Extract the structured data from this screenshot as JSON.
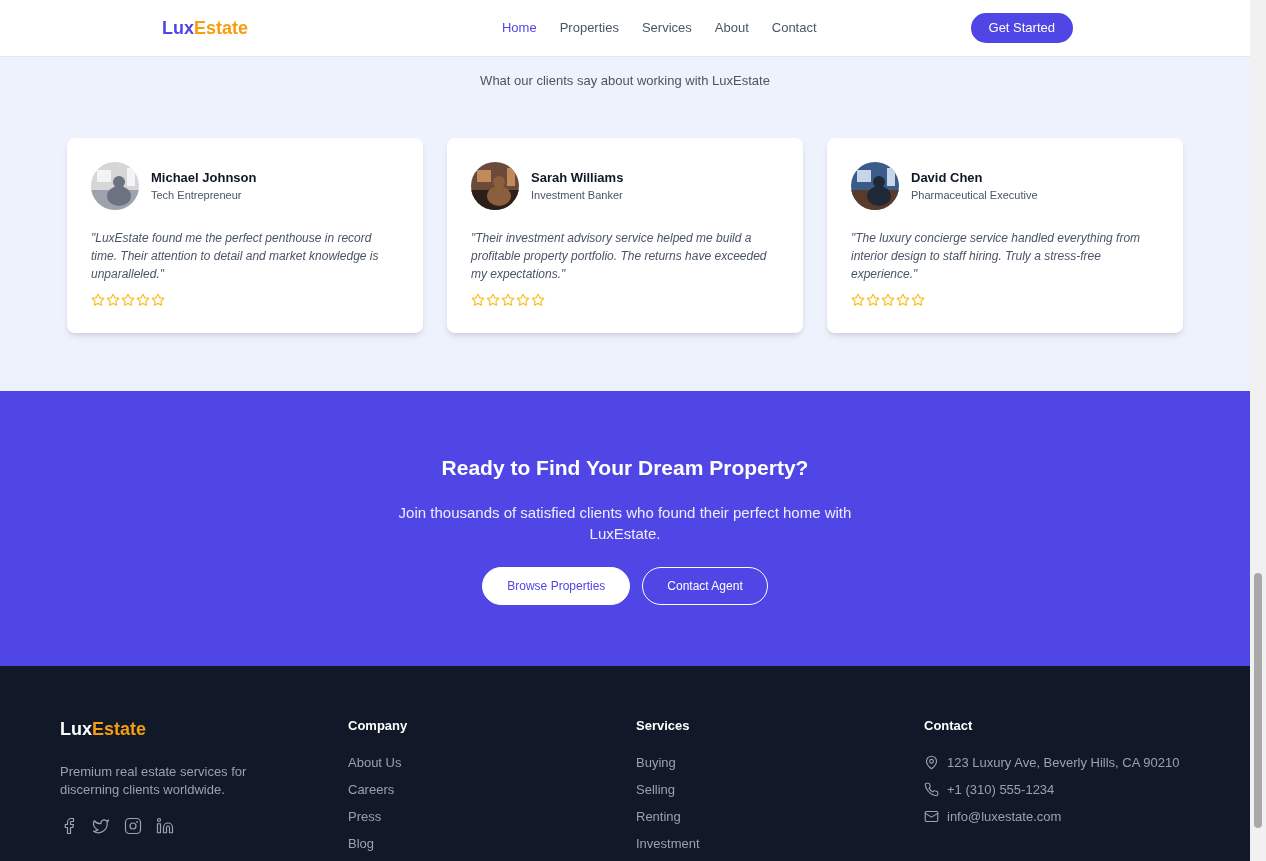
{
  "nav": {
    "logo": {
      "first": "Lux",
      "second": "Estate"
    },
    "links": [
      {
        "label": "Home",
        "selected": true
      },
      {
        "label": "Properties",
        "selected": false
      },
      {
        "label": "Services",
        "selected": false
      },
      {
        "label": "About",
        "selected": false
      },
      {
        "label": "Contact",
        "selected": false
      }
    ],
    "cta": "Get Started"
  },
  "testimonials": {
    "subtitle": "What our clients say about working with LuxEstate",
    "items": [
      {
        "name": "Michael Johnson",
        "role": "Tech Entrepreneur",
        "quote": "\"LuxEstate found me the perfect penthouse in record time. Their attention to detail and market knowledge is unparalleled.\"",
        "stars": 0
      },
      {
        "name": "Sarah Williams",
        "role": "Investment Banker",
        "quote": "\"Their investment advisory service helped me build a profitable property portfolio. The returns have exceeded my expectations.\"",
        "stars": 0
      },
      {
        "name": "David Chen",
        "role": "Pharmaceutical Executive",
        "quote": "\"The luxury concierge service handled everything from interior design to staff hiring. Truly a stress-free experience.\"",
        "stars": 0
      }
    ]
  },
  "cta_section": {
    "title": "Ready to Find Your Dream Property?",
    "text": "Join thousands of satisfied clients who found their perfect home with LuxEstate.",
    "buttons": [
      {
        "label": "Browse Properties",
        "kind": "solid"
      },
      {
        "label": "Contact Agent",
        "kind": "outline"
      }
    ]
  },
  "footer": {
    "logo": {
      "first": "Lux",
      "second": "Estate"
    },
    "tagline": "Premium real estate services for discerning clients worldwide.",
    "social": [
      {
        "kind": "facebook"
      },
      {
        "kind": "twitter"
      },
      {
        "kind": "instagram"
      },
      {
        "kind": "linkedin"
      }
    ],
    "columns": [
      {
        "title": "Company",
        "links": [
          "About Us",
          "Careers",
          "Press",
          "Blog"
        ]
      },
      {
        "title": "Services",
        "links": [
          "Buying",
          "Selling",
          "Renting",
          "Investment"
        ]
      }
    ],
    "contact": {
      "title": "Contact",
      "items": [
        {
          "kind": "address",
          "text": "123 Luxury Ave, Beverly Hills, CA 90210"
        },
        {
          "kind": "phone",
          "text": "+1 (310) 555-1234"
        },
        {
          "kind": "email",
          "text": "info@luxestate.com"
        }
      ]
    }
  }
}
